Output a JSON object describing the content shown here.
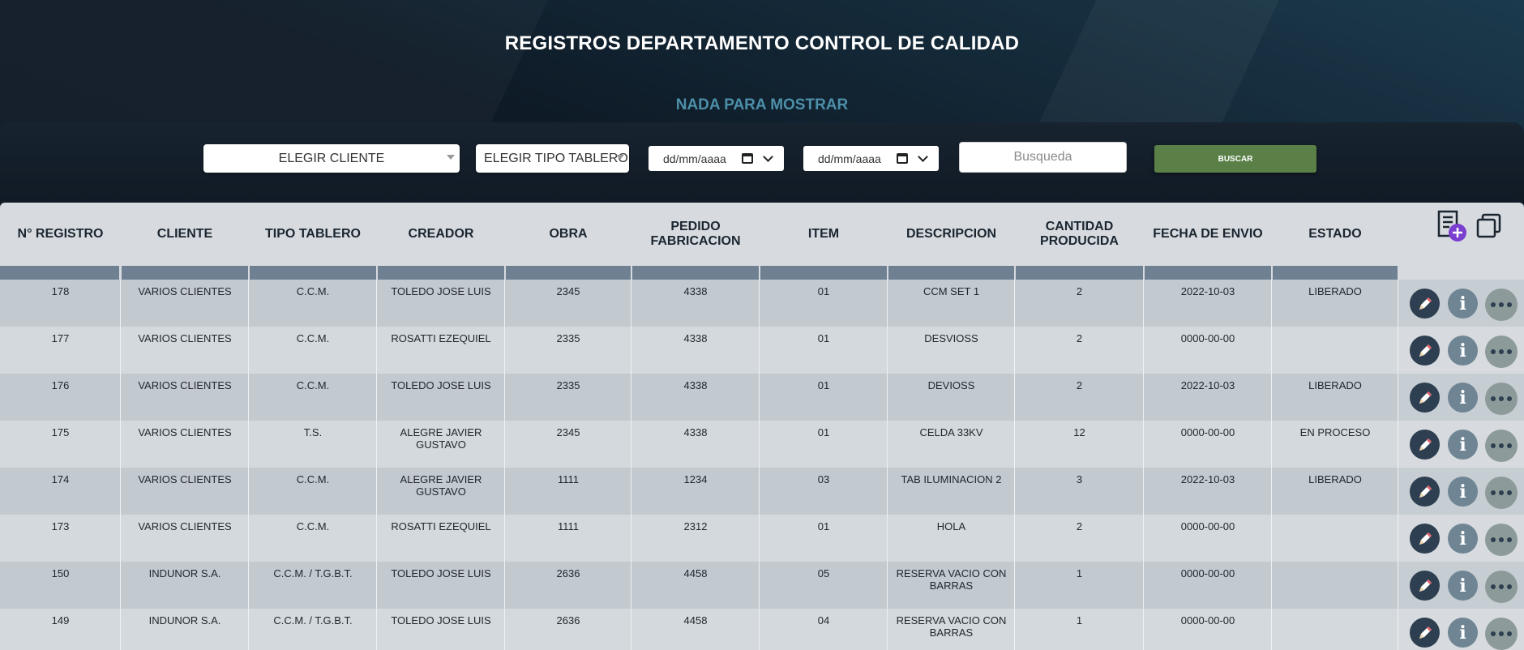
{
  "header": {
    "title": "REGISTROS DEPARTAMENTO CONTROL DE CALIDAD",
    "message": "NADA PARA MOSTRAR"
  },
  "filters": {
    "cliente_select": "ELEGIR CLIENTE",
    "tipo_select": "ELEGIR TIPO TABLERO",
    "date_from": "dd/mm/aaaa",
    "date_to": "dd/mm/aaaa",
    "search_placeholder": "Busqueda",
    "search_button": "BUSCAR"
  },
  "table": {
    "columns": [
      "N° REGISTRO",
      "CLIENTE",
      "TIPO TABLERO",
      "CREADOR",
      "OBRA",
      "PEDIDO\nFABRICACION",
      "ITEM",
      "DESCRIPCION",
      "CANTIDAD\nPRODUCIDA",
      "FECHA DE ENVIO",
      "ESTADO"
    ],
    "rows": [
      [
        "178",
        "VARIOS CLIENTES",
        "C.C.M.",
        "TOLEDO JOSE LUIS",
        "2345",
        "4338",
        "01",
        "CCM SET 1",
        "2",
        "2022-10-03",
        "LIBERADO"
      ],
      [
        "177",
        "VARIOS CLIENTES",
        "C.C.M.",
        "ROSATTI EZEQUIEL",
        "2335",
        "4338",
        "01",
        "DESVIOSS",
        "2",
        "0000-00-00",
        ""
      ],
      [
        "176",
        "VARIOS CLIENTES",
        "C.C.M.",
        "TOLEDO JOSE LUIS",
        "2335",
        "4338",
        "01",
        "DEVIOSS",
        "2",
        "2022-10-03",
        "LIBERADO"
      ],
      [
        "175",
        "VARIOS CLIENTES",
        "T.S.",
        "ALEGRE JAVIER GUSTAVO",
        "2345",
        "4338",
        "01",
        "CELDA 33KV",
        "12",
        "0000-00-00",
        "EN PROCESO"
      ],
      [
        "174",
        "VARIOS CLIENTES",
        "C.C.M.",
        "ALEGRE JAVIER GUSTAVO",
        "1111",
        "1234",
        "03",
        "TAB ILUMINACION 2",
        "3",
        "2022-10-03",
        "LIBERADO"
      ],
      [
        "173",
        "VARIOS CLIENTES",
        "C.C.M.",
        "ROSATTI EZEQUIEL",
        "1111",
        "2312",
        "01",
        "HOLA",
        "2",
        "0000-00-00",
        ""
      ],
      [
        "150",
        "INDUNOR S.A.",
        "C.C.M. / T.G.B.T.",
        "TOLEDO JOSE LUIS",
        "2636",
        "4458",
        "05",
        "RESERVA VACIO CON BARRAS",
        "1",
        "0000-00-00",
        ""
      ],
      [
        "149",
        "INDUNOR S.A.",
        "C.C.M. / T.G.B.T.",
        "TOLEDO JOSE LUIS",
        "2636",
        "4458",
        "04",
        "RESERVA VACIO CON BARRAS",
        "1",
        "0000-00-00",
        ""
      ]
    ]
  },
  "icons": {
    "add_record": "add-record-icon",
    "copy": "copy-icon",
    "edit": "pencil-icon",
    "info": "info-icon",
    "more": "more-options-icon"
  },
  "colors": {
    "accent_green": "#5a8048",
    "message_blue": "#4d8fa9",
    "add_badge": "#7b3fd0"
  }
}
